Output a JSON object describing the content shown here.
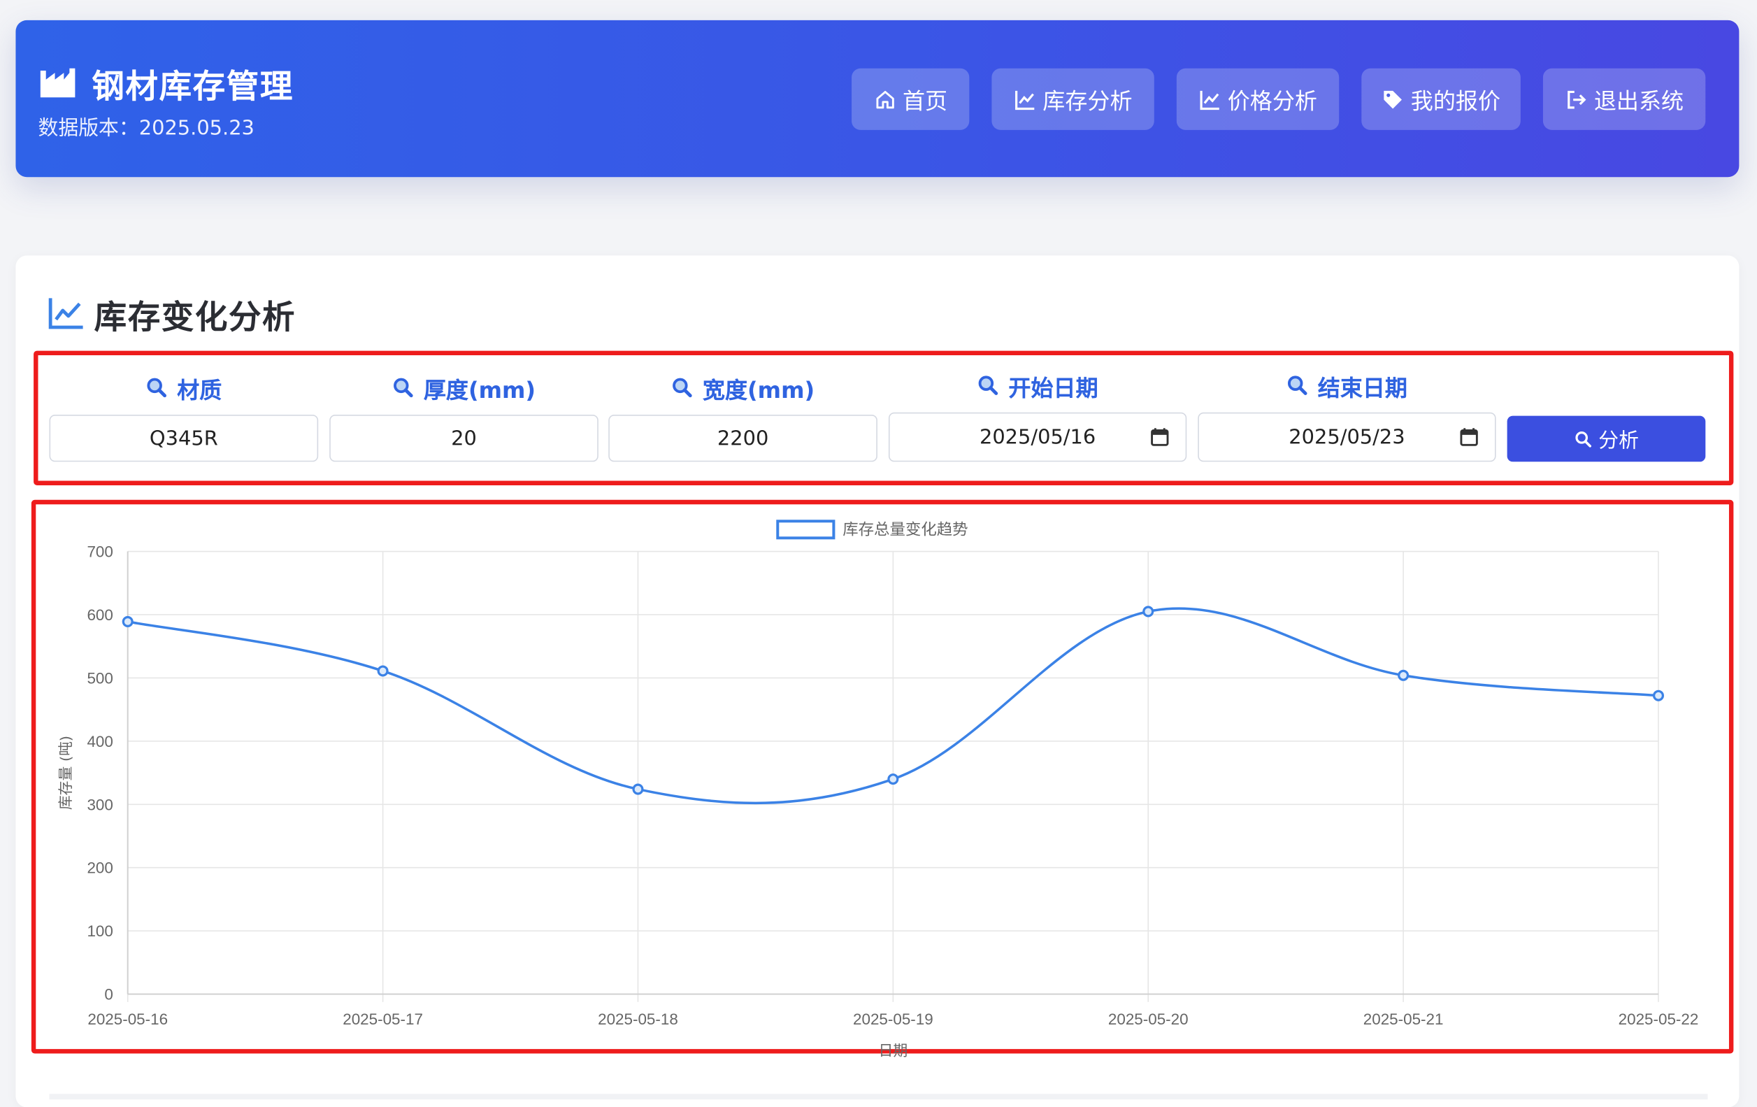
{
  "header": {
    "title": "钢材库存管理",
    "version_text": "数据版本：2025.05.23",
    "nav": [
      {
        "label": "首页",
        "icon": "home-icon"
      },
      {
        "label": "库存分析",
        "icon": "chart-line-icon"
      },
      {
        "label": "价格分析",
        "icon": "chart-line-icon"
      },
      {
        "label": "我的报价",
        "icon": "tag-icon"
      },
      {
        "label": "退出系统",
        "icon": "sign-out-icon"
      }
    ]
  },
  "section": {
    "title": "库存变化分析",
    "icon": "chart-line-icon"
  },
  "filters": {
    "material": {
      "label": "材质",
      "value": "Q345R"
    },
    "thickness": {
      "label": "厚度(mm)",
      "value": "20"
    },
    "width": {
      "label": "宽度(mm)",
      "value": "2200"
    },
    "start_date": {
      "label": "开始日期",
      "value": "2025/05/16"
    },
    "end_date": {
      "label": "结束日期",
      "value": "2025/05/23"
    },
    "analyze_label": "分析"
  },
  "colors": {
    "accent": "#3b82e6",
    "primary_button": "#3b4fe0",
    "header_start": "#2f62e8",
    "header_end": "#4848e2",
    "highlight": "#ee1c1c"
  },
  "chart_data": {
    "type": "line",
    "x": [
      "2025-05-16",
      "2025-05-17",
      "2025-05-18",
      "2025-05-19",
      "2025-05-20",
      "2025-05-21",
      "2025-05-22"
    ],
    "series": [
      {
        "name": "库存总量变化趋势",
        "values": [
          589,
          511,
          324,
          340,
          605,
          504,
          472
        ]
      }
    ],
    "ylabel": "库存量 (吨)",
    "xlabel": "日期",
    "ylim": [
      0,
      700
    ],
    "yticks": [
      0,
      100,
      200,
      300,
      400,
      500,
      600,
      700
    ],
    "grid": true,
    "legend_position": "top-center"
  }
}
